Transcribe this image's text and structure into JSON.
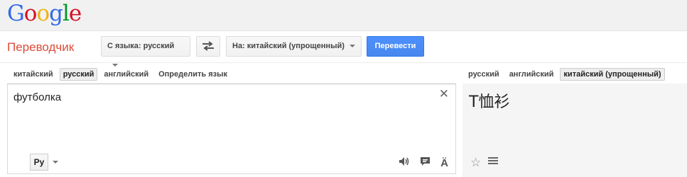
{
  "header": {
    "logo_letters": [
      "G",
      "o",
      "o",
      "g",
      "l",
      "e"
    ],
    "logo_colors": [
      "#3369e8",
      "#d50f25",
      "#eeb211",
      "#3369e8",
      "#009925",
      "#d50f25"
    ]
  },
  "toolbar": {
    "product_title": "Переводчик",
    "source_select": "С языка: русский",
    "swap_icon": "swap-arrows-icon",
    "target_select": "На: китайский (упрощенный)",
    "translate_label": "Перевести"
  },
  "source_tabs": [
    {
      "label": "китайский",
      "active": false
    },
    {
      "label": "русский",
      "active": true
    },
    {
      "label": "английский",
      "active": false
    },
    {
      "label": "Определить язык",
      "active": false
    }
  ],
  "target_tabs": [
    {
      "label": "русский",
      "active": false
    },
    {
      "label": "английский",
      "active": false
    },
    {
      "label": "китайский (упрощенный)",
      "active": true
    }
  ],
  "source": {
    "text": "футболка",
    "ime_label": "Ру",
    "icons": [
      "speaker-icon",
      "feedback-icon",
      "virtual-keyboard-icon"
    ]
  },
  "target": {
    "text": "T恤衫",
    "icons": [
      "star-icon",
      "list-icon"
    ]
  },
  "colors": {
    "accent_blue": "#4d90fe",
    "product_red": "#dd4b39"
  }
}
